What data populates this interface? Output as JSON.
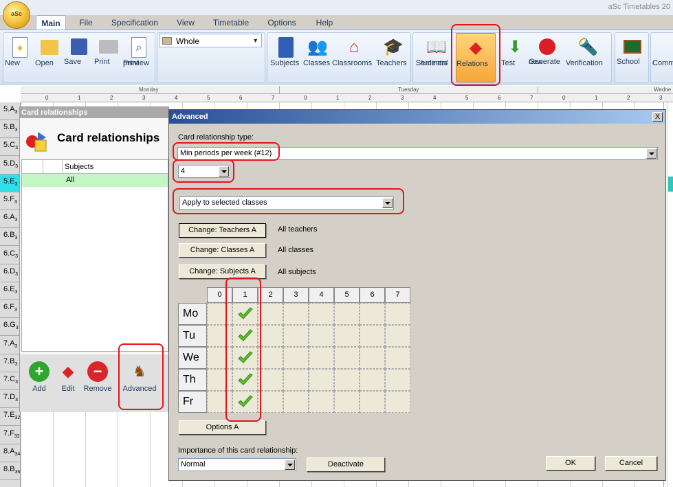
{
  "window": {
    "app_title": "aSc Timetables 20",
    "orb_label": "aSc"
  },
  "menu": [
    "Main",
    "File",
    "Specification",
    "View",
    "Timetable",
    "Options",
    "Help"
  ],
  "ribbon": {
    "new": "New",
    "open": "Open",
    "save": "Save",
    "print": "Print",
    "print_preview": [
      "Print",
      "preview"
    ],
    "scope_select": "Whole",
    "subjects": "Subjects",
    "classes": "Classes",
    "classrooms": "Classrooms",
    "teachers": "Teachers",
    "students_seminars": [
      "Students/",
      "Seminars"
    ],
    "relations": "Relations",
    "test": "Test",
    "generate_new": [
      "Generate",
      "new"
    ],
    "verification": "Verification",
    "school": "School",
    "common": [
      "C",
      "Comm"
    ]
  },
  "timetable": {
    "days": [
      "Monday",
      "Tuesday",
      "Wedne"
    ],
    "periods": [
      "0",
      "1",
      "2",
      "3",
      "4",
      "5",
      "6",
      "7",
      "0",
      "1",
      "2",
      "3",
      "4",
      "5",
      "6",
      "7",
      "0",
      "1",
      "2",
      "3"
    ],
    "classes": [
      {
        "name": "5.A",
        "num": "3"
      },
      {
        "name": "5.B",
        "num": "3"
      },
      {
        "name": "5.C",
        "num": "3"
      },
      {
        "name": "5.D",
        "num": "3"
      },
      {
        "name": "5.E",
        "num": "3"
      },
      {
        "name": "5.F",
        "num": "3"
      },
      {
        "name": "6.A",
        "num": "3"
      },
      {
        "name": "6.B",
        "num": "3"
      },
      {
        "name": "6.C",
        "num": "3"
      },
      {
        "name": "6.D",
        "num": "3"
      },
      {
        "name": "6.E",
        "num": "3"
      },
      {
        "name": "6.F",
        "num": "3"
      },
      {
        "name": "6.G",
        "num": "3"
      },
      {
        "name": "7.A",
        "num": "3"
      },
      {
        "name": "7.B",
        "num": "3"
      },
      {
        "name": "7.C",
        "num": "3"
      },
      {
        "name": "7.D",
        "num": "3"
      },
      {
        "name": "7.E",
        "num": "32"
      },
      {
        "name": "7.F",
        "num": "32"
      },
      {
        "name": "8.A",
        "num": "34"
      },
      {
        "name": "8.B",
        "num": "36"
      }
    ]
  },
  "card_panel": {
    "window_title": "Card relationships",
    "heading": "Card relationships",
    "column_subjects": "Subjects",
    "row_all": "All",
    "add": "Add",
    "edit": "Edit",
    "remove": "Remove",
    "advanced": "Advanced"
  },
  "dialog": {
    "title": "Advanced",
    "close": "X",
    "type_label": "Card relationship type:",
    "type_value": "Min periods per week (#12)",
    "count_value": "4",
    "apply_value": "Apply to selected classes",
    "change_teachers": "Change: Teachers A",
    "teachers_info": "All teachers",
    "change_classes": "Change: Classes A",
    "classes_info": "All classes",
    "change_subjects": "Change: Subjects A",
    "subjects_info": "All subjects",
    "matrix_periods": [
      "0",
      "1",
      "2",
      "3",
      "4",
      "5",
      "6",
      "7"
    ],
    "matrix_days": [
      "Mo",
      "Tu",
      "We",
      "Th",
      "Fr"
    ],
    "checked_period": 1,
    "options": "Options A",
    "importance_label": "Importance of this card relationship:",
    "importance_value": "Normal",
    "deactivate": "Deactivate",
    "ok": "OK",
    "cancel": "Cancel"
  },
  "colors": {
    "highlight": "#f8a63a",
    "annotation_red": "#e4141c",
    "selected_row": "#c4f5c4",
    "selected_class": "#2fe0e8",
    "check_green": "#5fbf2c"
  }
}
